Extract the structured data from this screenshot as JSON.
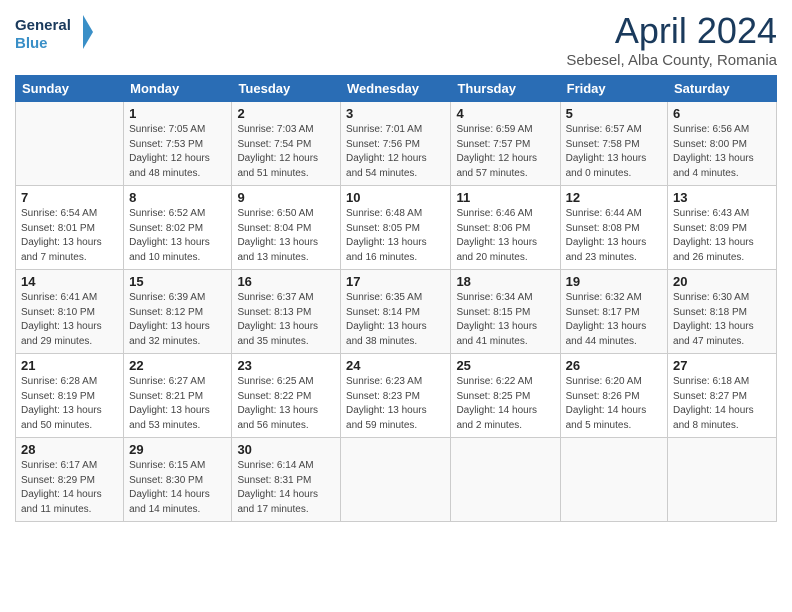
{
  "header": {
    "logo_general": "General",
    "logo_blue": "Blue",
    "title": "April 2024",
    "location": "Sebesel, Alba County, Romania"
  },
  "days_of_week": [
    "Sunday",
    "Monday",
    "Tuesday",
    "Wednesday",
    "Thursday",
    "Friday",
    "Saturday"
  ],
  "weeks": [
    [
      {
        "day": "",
        "sunrise": "",
        "sunset": "",
        "daylight": ""
      },
      {
        "day": "1",
        "sunrise": "Sunrise: 7:05 AM",
        "sunset": "Sunset: 7:53 PM",
        "daylight": "Daylight: 12 hours and 48 minutes."
      },
      {
        "day": "2",
        "sunrise": "Sunrise: 7:03 AM",
        "sunset": "Sunset: 7:54 PM",
        "daylight": "Daylight: 12 hours and 51 minutes."
      },
      {
        "day": "3",
        "sunrise": "Sunrise: 7:01 AM",
        "sunset": "Sunset: 7:56 PM",
        "daylight": "Daylight: 12 hours and 54 minutes."
      },
      {
        "day": "4",
        "sunrise": "Sunrise: 6:59 AM",
        "sunset": "Sunset: 7:57 PM",
        "daylight": "Daylight: 12 hours and 57 minutes."
      },
      {
        "day": "5",
        "sunrise": "Sunrise: 6:57 AM",
        "sunset": "Sunset: 7:58 PM",
        "daylight": "Daylight: 13 hours and 0 minutes."
      },
      {
        "day": "6",
        "sunrise": "Sunrise: 6:56 AM",
        "sunset": "Sunset: 8:00 PM",
        "daylight": "Daylight: 13 hours and 4 minutes."
      }
    ],
    [
      {
        "day": "7",
        "sunrise": "Sunrise: 6:54 AM",
        "sunset": "Sunset: 8:01 PM",
        "daylight": "Daylight: 13 hours and 7 minutes."
      },
      {
        "day": "8",
        "sunrise": "Sunrise: 6:52 AM",
        "sunset": "Sunset: 8:02 PM",
        "daylight": "Daylight: 13 hours and 10 minutes."
      },
      {
        "day": "9",
        "sunrise": "Sunrise: 6:50 AM",
        "sunset": "Sunset: 8:04 PM",
        "daylight": "Daylight: 13 hours and 13 minutes."
      },
      {
        "day": "10",
        "sunrise": "Sunrise: 6:48 AM",
        "sunset": "Sunset: 8:05 PM",
        "daylight": "Daylight: 13 hours and 16 minutes."
      },
      {
        "day": "11",
        "sunrise": "Sunrise: 6:46 AM",
        "sunset": "Sunset: 8:06 PM",
        "daylight": "Daylight: 13 hours and 20 minutes."
      },
      {
        "day": "12",
        "sunrise": "Sunrise: 6:44 AM",
        "sunset": "Sunset: 8:08 PM",
        "daylight": "Daylight: 13 hours and 23 minutes."
      },
      {
        "day": "13",
        "sunrise": "Sunrise: 6:43 AM",
        "sunset": "Sunset: 8:09 PM",
        "daylight": "Daylight: 13 hours and 26 minutes."
      }
    ],
    [
      {
        "day": "14",
        "sunrise": "Sunrise: 6:41 AM",
        "sunset": "Sunset: 8:10 PM",
        "daylight": "Daylight: 13 hours and 29 minutes."
      },
      {
        "day": "15",
        "sunrise": "Sunrise: 6:39 AM",
        "sunset": "Sunset: 8:12 PM",
        "daylight": "Daylight: 13 hours and 32 minutes."
      },
      {
        "day": "16",
        "sunrise": "Sunrise: 6:37 AM",
        "sunset": "Sunset: 8:13 PM",
        "daylight": "Daylight: 13 hours and 35 minutes."
      },
      {
        "day": "17",
        "sunrise": "Sunrise: 6:35 AM",
        "sunset": "Sunset: 8:14 PM",
        "daylight": "Daylight: 13 hours and 38 minutes."
      },
      {
        "day": "18",
        "sunrise": "Sunrise: 6:34 AM",
        "sunset": "Sunset: 8:15 PM",
        "daylight": "Daylight: 13 hours and 41 minutes."
      },
      {
        "day": "19",
        "sunrise": "Sunrise: 6:32 AM",
        "sunset": "Sunset: 8:17 PM",
        "daylight": "Daylight: 13 hours and 44 minutes."
      },
      {
        "day": "20",
        "sunrise": "Sunrise: 6:30 AM",
        "sunset": "Sunset: 8:18 PM",
        "daylight": "Daylight: 13 hours and 47 minutes."
      }
    ],
    [
      {
        "day": "21",
        "sunrise": "Sunrise: 6:28 AM",
        "sunset": "Sunset: 8:19 PM",
        "daylight": "Daylight: 13 hours and 50 minutes."
      },
      {
        "day": "22",
        "sunrise": "Sunrise: 6:27 AM",
        "sunset": "Sunset: 8:21 PM",
        "daylight": "Daylight: 13 hours and 53 minutes."
      },
      {
        "day": "23",
        "sunrise": "Sunrise: 6:25 AM",
        "sunset": "Sunset: 8:22 PM",
        "daylight": "Daylight: 13 hours and 56 minutes."
      },
      {
        "day": "24",
        "sunrise": "Sunrise: 6:23 AM",
        "sunset": "Sunset: 8:23 PM",
        "daylight": "Daylight: 13 hours and 59 minutes."
      },
      {
        "day": "25",
        "sunrise": "Sunrise: 6:22 AM",
        "sunset": "Sunset: 8:25 PM",
        "daylight": "Daylight: 14 hours and 2 minutes."
      },
      {
        "day": "26",
        "sunrise": "Sunrise: 6:20 AM",
        "sunset": "Sunset: 8:26 PM",
        "daylight": "Daylight: 14 hours and 5 minutes."
      },
      {
        "day": "27",
        "sunrise": "Sunrise: 6:18 AM",
        "sunset": "Sunset: 8:27 PM",
        "daylight": "Daylight: 14 hours and 8 minutes."
      }
    ],
    [
      {
        "day": "28",
        "sunrise": "Sunrise: 6:17 AM",
        "sunset": "Sunset: 8:29 PM",
        "daylight": "Daylight: 14 hours and 11 minutes."
      },
      {
        "day": "29",
        "sunrise": "Sunrise: 6:15 AM",
        "sunset": "Sunset: 8:30 PM",
        "daylight": "Daylight: 14 hours and 14 minutes."
      },
      {
        "day": "30",
        "sunrise": "Sunrise: 6:14 AM",
        "sunset": "Sunset: 8:31 PM",
        "daylight": "Daylight: 14 hours and 17 minutes."
      },
      {
        "day": "",
        "sunrise": "",
        "sunset": "",
        "daylight": ""
      },
      {
        "day": "",
        "sunrise": "",
        "sunset": "",
        "daylight": ""
      },
      {
        "day": "",
        "sunrise": "",
        "sunset": "",
        "daylight": ""
      },
      {
        "day": "",
        "sunrise": "",
        "sunset": "",
        "daylight": ""
      }
    ]
  ]
}
